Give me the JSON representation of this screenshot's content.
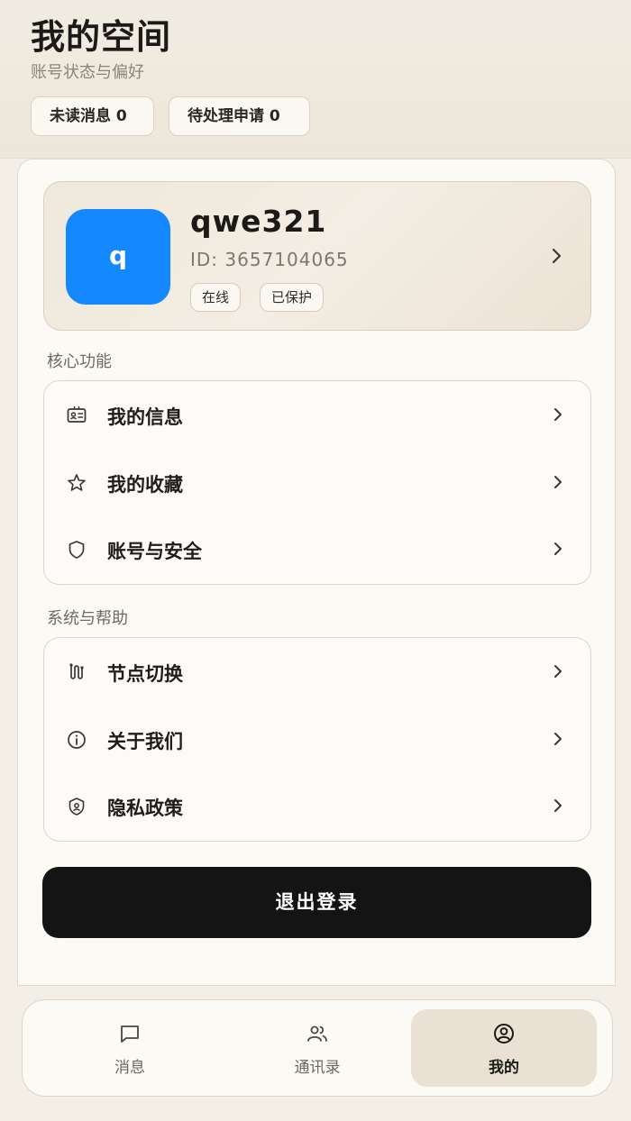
{
  "header": {
    "title": "我的空间",
    "subtitle": "账号状态与偏好",
    "chips": [
      {
        "label": "未读消息 0"
      },
      {
        "label": "待处理申请 0"
      }
    ]
  },
  "profile": {
    "avatar_letter": "q",
    "avatar_color": "#1388ff",
    "username": "qwe321",
    "id_text": "ID: 3657104065",
    "tags": [
      "在线",
      "已保护"
    ]
  },
  "sections": [
    {
      "label": "核心功能",
      "items": [
        {
          "label": "我的信息",
          "icon": "id-card-icon"
        },
        {
          "label": "我的收藏",
          "icon": "star-icon"
        },
        {
          "label": "账号与安全",
          "icon": "shield-icon"
        }
      ]
    },
    {
      "label": "系统与帮助",
      "items": [
        {
          "label": "节点切换",
          "icon": "route-icon"
        },
        {
          "label": "关于我们",
          "icon": "info-icon"
        },
        {
          "label": "隐私政策",
          "icon": "privacy-shield-icon"
        }
      ]
    }
  ],
  "logout_label": "退出登录",
  "tabs": [
    {
      "label": "消息",
      "icon": "message-icon"
    },
    {
      "label": "通讯录",
      "icon": "contacts-icon"
    },
    {
      "label": "我的",
      "icon": "user-circle-icon",
      "active": true
    }
  ]
}
